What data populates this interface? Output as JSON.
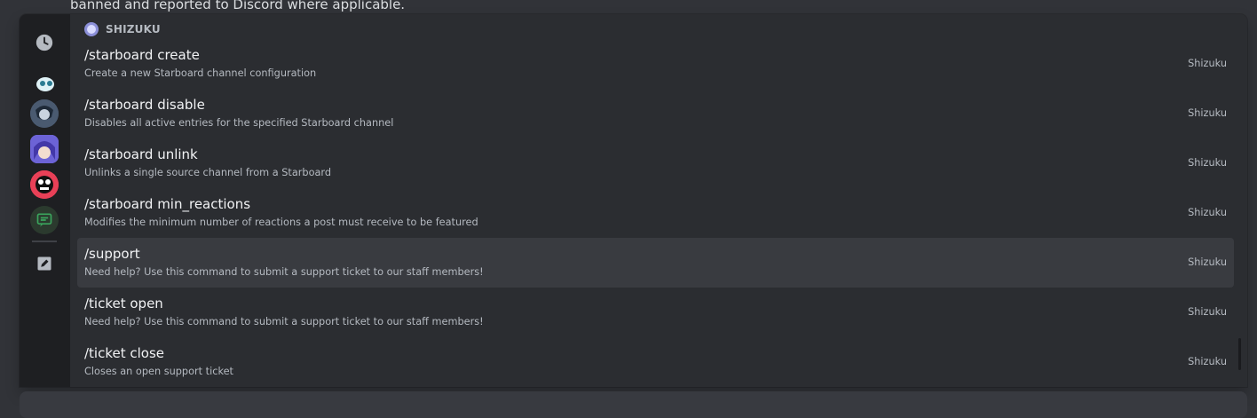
{
  "background": {
    "message_text": "banned and reported to Discord where applicable."
  },
  "rail": {
    "items": [
      {
        "name": "recent-icon"
      },
      {
        "name": "app-icon-1"
      },
      {
        "name": "app-icon-2"
      },
      {
        "name": "app-icon-shizuku"
      },
      {
        "name": "app-icon-4"
      },
      {
        "name": "chat-icon"
      },
      {
        "name": "edit-icon"
      }
    ]
  },
  "section": {
    "app_name": "SHIZUKU"
  },
  "commands": [
    {
      "name": "/starboard create",
      "description": "Create a new Starboard channel configuration",
      "source": "Shizuku"
    },
    {
      "name": "/starboard disable",
      "description": "Disables all active entries for the specified Starboard channel",
      "source": "Shizuku"
    },
    {
      "name": "/starboard unlink",
      "description": "Unlinks a single source channel from a Starboard",
      "source": "Shizuku"
    },
    {
      "name": "/starboard min_reactions",
      "description": "Modifies the minimum number of reactions a post must receive to be featured",
      "source": "Shizuku"
    },
    {
      "name": "/support",
      "description": "Need help? Use this command to submit a support ticket to our staff members!",
      "source": "Shizuku",
      "selected": true
    },
    {
      "name": "/ticket open",
      "description": "Need help? Use this command to submit a support ticket to our staff members!",
      "source": "Shizuku"
    },
    {
      "name": "/ticket close",
      "description": "Closes an open support ticket",
      "source": "Shizuku"
    }
  ],
  "colors": {
    "background": "#313338",
    "popup": "#2b2d31",
    "rail": "#1e1f22",
    "selected_row": "#393b40",
    "text_primary": "#f2f3f5",
    "text_muted": "#b5bac1"
  }
}
